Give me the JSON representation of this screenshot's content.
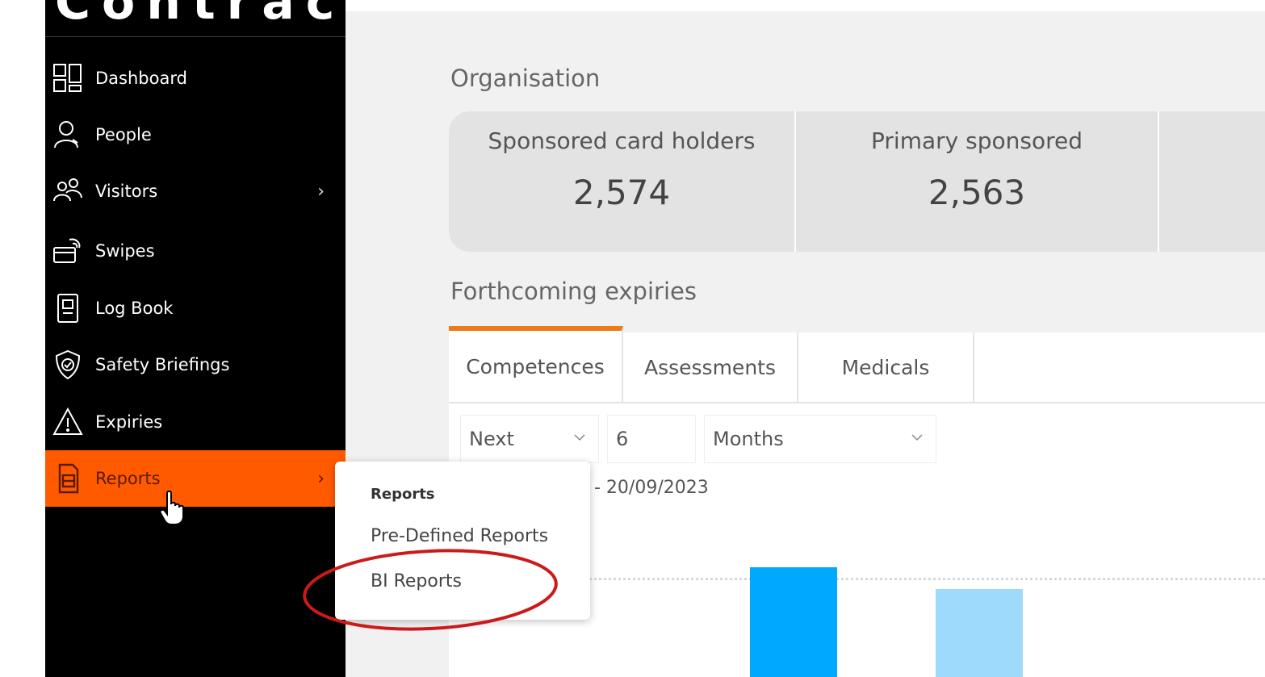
{
  "sidebar": {
    "brand": "Contract",
    "items": [
      {
        "label": "Dashboard",
        "icon": "dashboard-grid-icon"
      },
      {
        "label": "People",
        "icon": "person-icon"
      },
      {
        "label": "Visitors",
        "icon": "visitors-group-icon",
        "chevron": "›"
      },
      {
        "label": "Swipes",
        "icon": "card-swipe-icon"
      },
      {
        "label": "Log Book",
        "icon": "logbook-icon"
      },
      {
        "label": "Safety Briefings",
        "icon": "shield-icon"
      },
      {
        "label": "Expiries",
        "icon": "warning-triangle-icon"
      },
      {
        "label": "Reports",
        "icon": "document-icon",
        "chevron": "›",
        "active": true
      }
    ]
  },
  "main": {
    "organisation_title": "Organisation",
    "stats": [
      {
        "label": "Sponsored card holders",
        "value": "2,574"
      },
      {
        "label": "Primary sponsored",
        "value": "2,563"
      }
    ],
    "expiries_title": "Forthcoming expiries",
    "tabs": [
      "Competences",
      "Assessments",
      "Medicals"
    ],
    "filters": {
      "direction": "Next",
      "amount": "6",
      "unit": "Months"
    },
    "date_range_text": "- 20/09/2023"
  },
  "chart_data": {
    "type": "bar",
    "title": "",
    "categories": [
      "",
      ""
    ],
    "values": [
      1.0,
      0.8
    ],
    "colors": [
      "#00a8ff",
      "#9ddafc"
    ]
  },
  "flyout": {
    "heading": "Reports",
    "items": [
      "Pre-Defined Reports",
      "BI Reports"
    ]
  },
  "colors": {
    "accent": "#ff5a00",
    "tab_accent": "#f07a1a",
    "annotation": "#cc1a1a"
  }
}
